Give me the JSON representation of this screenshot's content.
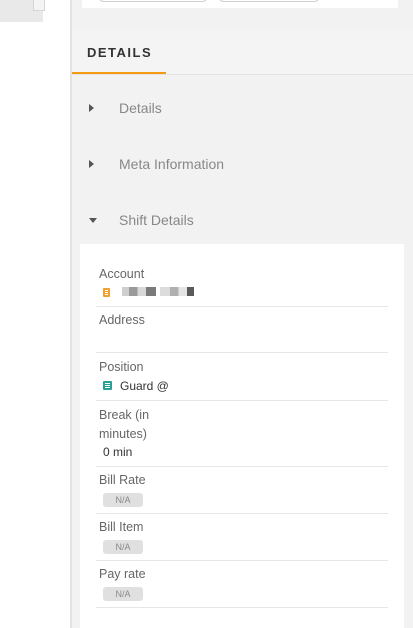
{
  "tab": {
    "label": "DETAILS"
  },
  "accordion": [
    {
      "label": "Details",
      "expanded": false
    },
    {
      "label": "Meta Information",
      "expanded": false
    },
    {
      "label": "Shift Details",
      "expanded": true
    }
  ],
  "shift_details": {
    "account": {
      "label": "Account",
      "value": ""
    },
    "address": {
      "label": "Address",
      "value": ""
    },
    "position": {
      "label": "Position",
      "value": "Guard @"
    },
    "break": {
      "label_line1": "Break (in",
      "label_line2": "minutes)",
      "value": "0 min"
    },
    "bill_rate": {
      "label": "Bill Rate",
      "value": "N/A"
    },
    "bill_item": {
      "label": "Bill Item",
      "value": "N/A"
    },
    "pay_rate": {
      "label": "Pay rate",
      "value": "N/A"
    }
  },
  "colors": {
    "accent": "#f39c12",
    "account_icon": "#f0a030",
    "position_icon": "#2aa198"
  }
}
